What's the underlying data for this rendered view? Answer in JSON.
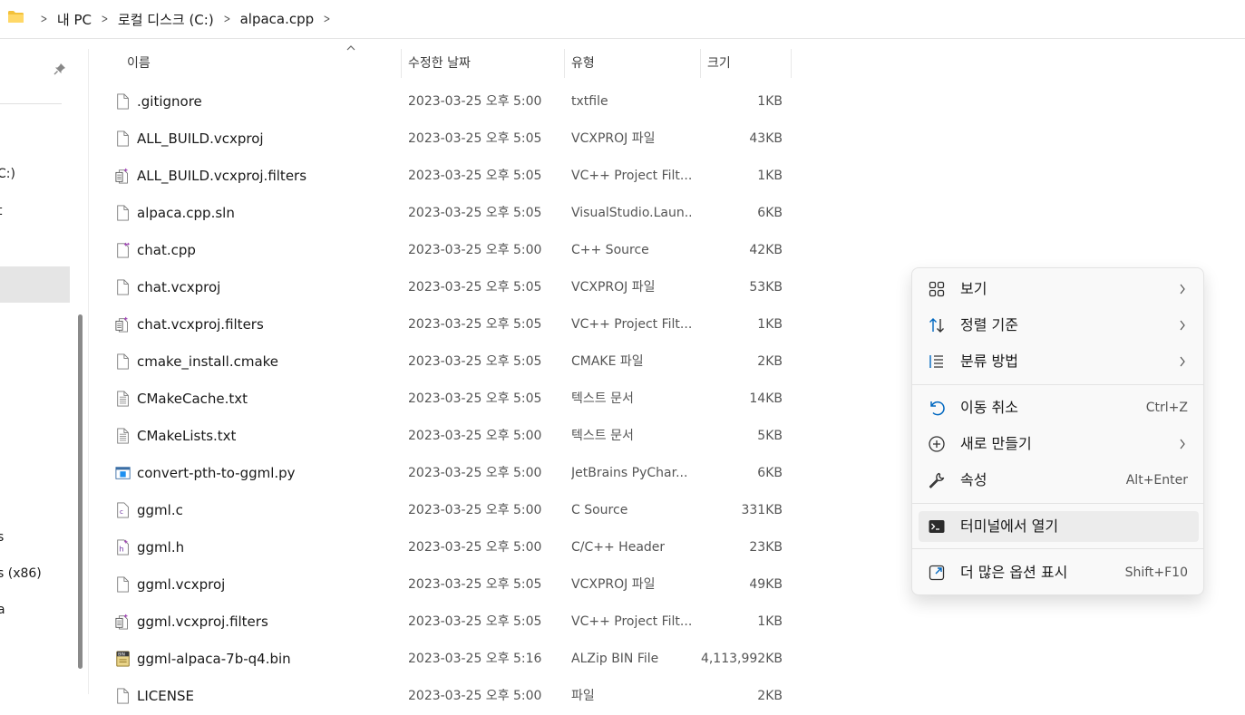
{
  "breadcrumb": {
    "items": [
      "내 PC",
      "로컬 디스크 (C:)",
      "alpaca.cpp"
    ]
  },
  "nav": {
    "fragments": [
      "C:)",
      "t",
      "s",
      "s (x86)",
      "a"
    ]
  },
  "columns": {
    "name": "이름",
    "date": "수정한 날짜",
    "type": "유형",
    "size": "크기"
  },
  "files": [
    {
      "name": ".gitignore",
      "date": "2023-03-25 오후 5:00",
      "type": "txtfile",
      "size": "1KB",
      "icon": "generic-file-icon"
    },
    {
      "name": "ALL_BUILD.vcxproj",
      "date": "2023-03-25 오후 5:05",
      "type": "VCXPROJ 파일",
      "size": "43KB",
      "icon": "generic-file-icon"
    },
    {
      "name": "ALL_BUILD.vcxproj.filters",
      "date": "2023-03-25 오후 5:05",
      "type": "VC++ Project Filt...",
      "size": "1KB",
      "icon": "vc-filters-file-icon"
    },
    {
      "name": "alpaca.cpp.sln",
      "date": "2023-03-25 오후 5:05",
      "type": "VisualStudio.Laun...",
      "size": "6KB",
      "icon": "generic-file-icon"
    },
    {
      "name": "chat.cpp",
      "date": "2023-03-25 오후 5:00",
      "type": "C++ Source",
      "size": "42KB",
      "icon": "cpp-file-icon"
    },
    {
      "name": "chat.vcxproj",
      "date": "2023-03-25 오후 5:05",
      "type": "VCXPROJ 파일",
      "size": "53KB",
      "icon": "generic-file-icon"
    },
    {
      "name": "chat.vcxproj.filters",
      "date": "2023-03-25 오후 5:05",
      "type": "VC++ Project Filt...",
      "size": "1KB",
      "icon": "vc-filters-file-icon"
    },
    {
      "name": "cmake_install.cmake",
      "date": "2023-03-25 오후 5:05",
      "type": "CMAKE 파일",
      "size": "2KB",
      "icon": "generic-file-icon"
    },
    {
      "name": "CMakeCache.txt",
      "date": "2023-03-25 오후 5:05",
      "type": "텍스트 문서",
      "size": "14KB",
      "icon": "text-file-icon"
    },
    {
      "name": "CMakeLists.txt",
      "date": "2023-03-25 오후 5:00",
      "type": "텍스트 문서",
      "size": "5KB",
      "icon": "text-file-icon"
    },
    {
      "name": "convert-pth-to-ggml.py",
      "date": "2023-03-25 오후 5:00",
      "type": "JetBrains PyChar...",
      "size": "6KB",
      "icon": "python-file-icon"
    },
    {
      "name": "ggml.c",
      "date": "2023-03-25 오후 5:00",
      "type": "C Source",
      "size": "331KB",
      "icon": "c-file-icon"
    },
    {
      "name": "ggml.h",
      "date": "2023-03-25 오후 5:00",
      "type": "C/C++ Header",
      "size": "23KB",
      "icon": "h-file-icon"
    },
    {
      "name": "ggml.vcxproj",
      "date": "2023-03-25 오후 5:05",
      "type": "VCXPROJ 파일",
      "size": "49KB",
      "icon": "generic-file-icon"
    },
    {
      "name": "ggml.vcxproj.filters",
      "date": "2023-03-25 오후 5:05",
      "type": "VC++ Project Filt...",
      "size": "1KB",
      "icon": "vc-filters-file-icon"
    },
    {
      "name": "ggml-alpaca-7b-q4.bin",
      "date": "2023-03-25 오후 5:16",
      "type": "ALZip BIN File",
      "size": "4,113,992KB",
      "icon": "bin-file-icon"
    },
    {
      "name": "LICENSE",
      "date": "2023-03-25 오후 5:00",
      "type": "파일",
      "size": "2KB",
      "icon": "generic-file-icon"
    }
  ],
  "context_menu": {
    "items": [
      {
        "label": "보기",
        "shortcut": "",
        "submenu": true,
        "icon": "view-grid-icon"
      },
      {
        "label": "정렬 기준",
        "shortcut": "",
        "submenu": true,
        "icon": "sort-arrows-icon"
      },
      {
        "label": "분류 방법",
        "shortcut": "",
        "submenu": true,
        "icon": "group-by-list-icon"
      },
      {
        "label": "이동 취소",
        "shortcut": "Ctrl+Z",
        "submenu": false,
        "icon": "undo-icon"
      },
      {
        "label": "새로 만들기",
        "shortcut": "",
        "submenu": true,
        "icon": "new-plus-icon"
      },
      {
        "label": "속성",
        "shortcut": "Alt+Enter",
        "submenu": false,
        "icon": "wrench-icon"
      },
      {
        "label": "터미널에서 열기",
        "shortcut": "",
        "submenu": false,
        "icon": "terminal-icon",
        "highlighted": true
      },
      {
        "label": "더 많은 옵션 표시",
        "shortcut": "Shift+F10",
        "submenu": false,
        "icon": "show-more-options-icon"
      }
    ]
  },
  "colors": {
    "accent": "#0067c0",
    "folder": "#f3c13a",
    "selection": "#e5e5e5",
    "menu_hover": "#ececec"
  }
}
